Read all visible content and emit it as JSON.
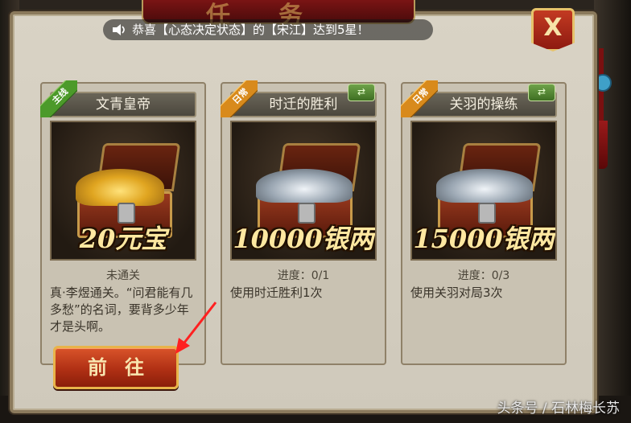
{
  "window": {
    "title": "任务"
  },
  "marquee": {
    "text": "恭喜【心态决定状态】的【宋江】达到5星！"
  },
  "close_button": {
    "label": "X"
  },
  "cards": [
    {
      "ribbon": "主线",
      "title": "文青皇帝",
      "reward": "20元宝",
      "status": "未通关",
      "description": "真·李煜通关。“问君能有几多愁”的名词，要背多少年才是头啊。",
      "ribbon_color": "#4c9a2a"
    },
    {
      "ribbon": "日常",
      "title": "时迁的胜利",
      "reward": "10000银两",
      "status": "进度：0/1",
      "description": "使用时迁胜利1次",
      "ribbon_color": "#d88a1c"
    },
    {
      "ribbon": "日常",
      "title": "关羽的操练",
      "reward": "15000银两",
      "status": "进度：0/3",
      "description": "使用关羽对局3次",
      "ribbon_color": "#d88a1c"
    }
  ],
  "go_button": {
    "label": "前往"
  },
  "watermark": "头条号 / 石林梅长苏"
}
